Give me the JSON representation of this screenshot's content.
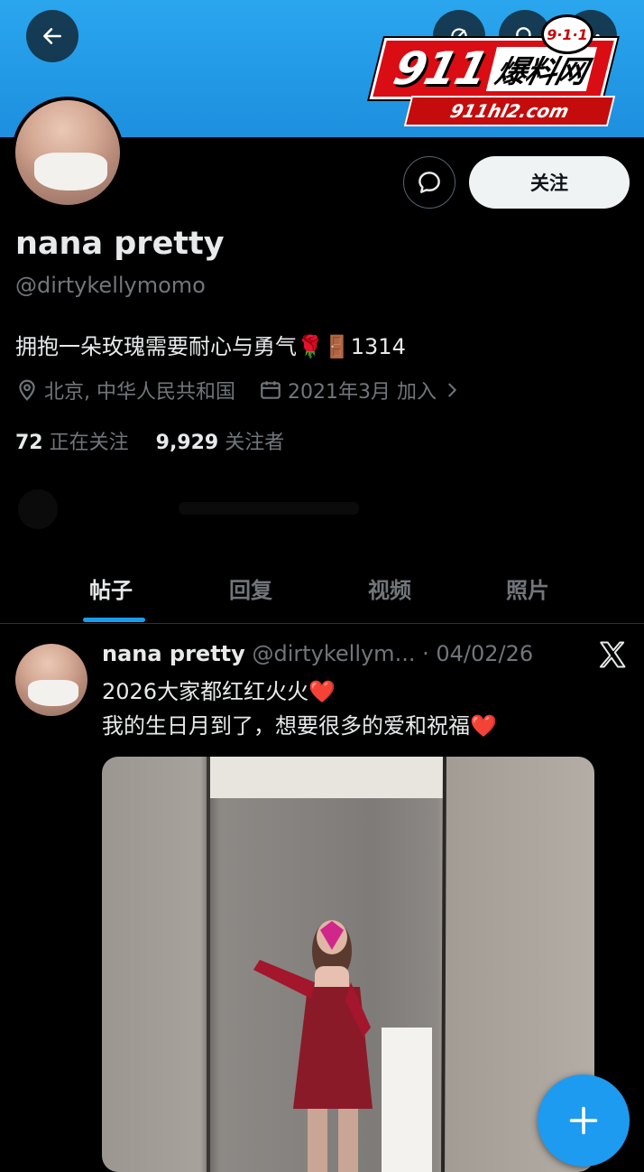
{
  "watermark": {
    "badge": "9·1·1",
    "number": "911",
    "brand": "爆料网",
    "url": "911hl2.com"
  },
  "profile": {
    "name": "nana pretty",
    "handle": "@dirtykellymomo",
    "bio": "拥抱一朵玫瑰需要耐心与勇气🌹🚪1314",
    "location": "北京, 中华人民共和国",
    "joined": "2021年3月 加入",
    "following_count": "72",
    "following_label": "正在关注",
    "followers_count": "9,929",
    "followers_label": "关注者",
    "follow_button": "关注"
  },
  "tabs": [
    {
      "label": "帖子",
      "active": true
    },
    {
      "label": "回复"
    },
    {
      "label": "视频"
    },
    {
      "label": "照片"
    }
  ],
  "post": {
    "author": "nana pretty",
    "handle": "@dirtykellym...",
    "date": "· 04/02/26",
    "line1": "2026大家都红红火火❤️",
    "line2": "我的生日月到了，想要很多的爱和祝福❤️"
  },
  "colors": {
    "banner": "#1d9bf0",
    "accent": "#1d9bf0",
    "background": "#000000"
  },
  "icons": [
    "back-arrow-icon",
    "grok-icon",
    "search-icon",
    "more-icon",
    "message-icon",
    "location-pin-icon",
    "calendar-icon",
    "chevron-right-icon",
    "x-logo-icon",
    "plus-icon"
  ]
}
